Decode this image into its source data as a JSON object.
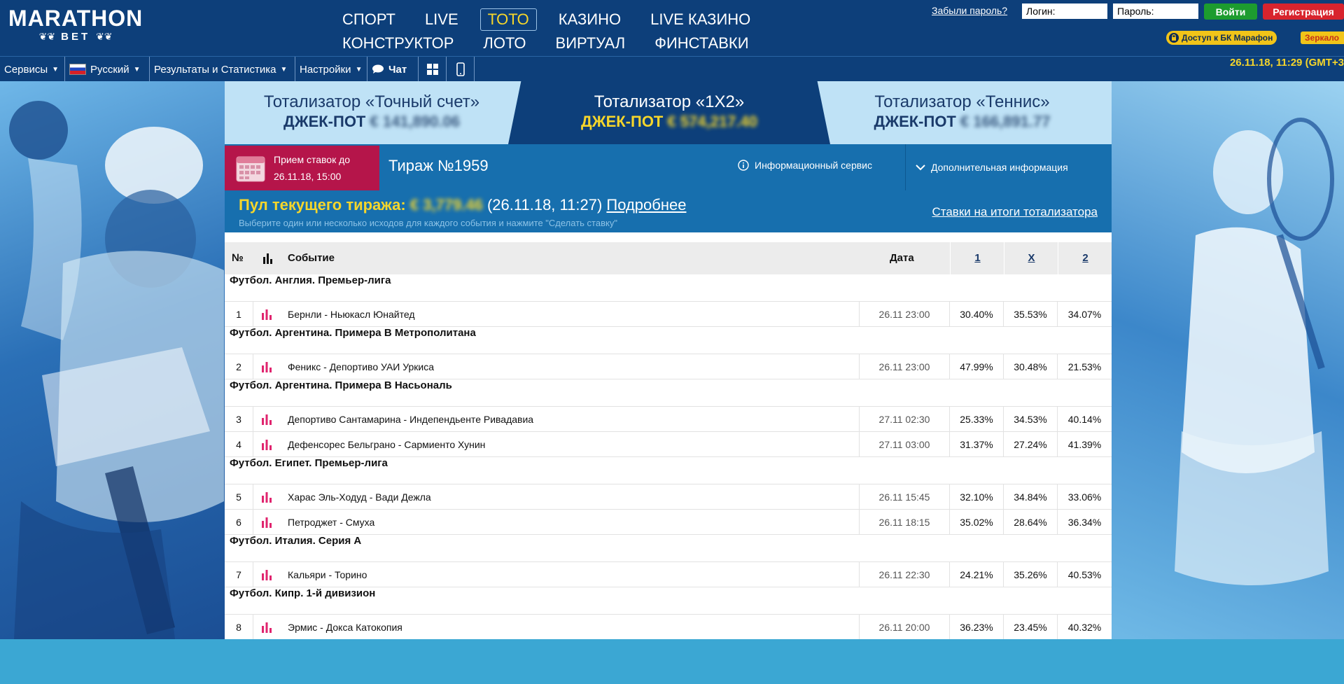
{
  "brand": {
    "name": "MARATHON",
    "sub": "BET",
    "accent": "#0d3f7a",
    "highlight": "#f6d62b"
  },
  "nav": {
    "row1": [
      "СПОРТ",
      "LIVE",
      "ТОТО",
      "КАЗИНО",
      "LIVE КАЗИНО"
    ],
    "row2": [
      "КОНСТРУКТОР",
      "ЛОТО",
      "ВИРТУАЛ",
      "ФИНСТАВКИ"
    ],
    "active": "ТОТО"
  },
  "auth": {
    "forgot": "Забыли пароль?",
    "login_placeholder": "Логин:",
    "password_placeholder": "Пароль:",
    "login_button": "Войти",
    "register_button": "Регистрация",
    "access": "Доступ к БК Марафон",
    "mirror": "Зеркало"
  },
  "toolbar": {
    "services": "Сервисы",
    "language": "Русский",
    "results": "Результаты и Статистика",
    "settings": "Настройки",
    "chat": "Чат",
    "datetime": "26.11.18, 11:29 (GMT+3"
  },
  "jackpots": [
    {
      "title": "Тотализатор «Точный счет»",
      "label": "ДЖЕК-ПОТ",
      "amount": "€ 141,890.06"
    },
    {
      "title": "Тотализатор «1X2»",
      "label": "ДЖЕК-ПОТ",
      "amount": "€ 574,217.40"
    },
    {
      "title": "Тотализатор «Теннис»",
      "label": "ДЖЕК-ПОТ",
      "amount": "€ 166,891.77"
    }
  ],
  "draw": {
    "deadline_label": "Прием ставок до",
    "deadline": "26.11.18, 15:00",
    "title": "Тираж №1959",
    "info_service": "Информационный сервис",
    "more_info": "Дополнительная информация",
    "pool_label": "Пул текущего тиража:",
    "pool_amount": "€ 3,779.46",
    "pool_time": "(26.11.18, 11:27)",
    "pool_more": "Подробнее",
    "hint": "Выберите один или несколько исходов для каждого события и нажмите \"Сделать ставку\"",
    "results_link": "Ставки на итоги тотализатора"
  },
  "table": {
    "headers": {
      "num": "№",
      "event": "Событие",
      "date": "Дата",
      "h1": "1",
      "hx": "X",
      "h2": "2"
    },
    "leagues": [
      {
        "name": "Футбол. Англия. Премьер-лига",
        "rows": [
          {
            "num": "1",
            "event": "Бернли - Ньюкасл Юнайтед",
            "date": "26.11 23:00",
            "p1": "30.40%",
            "px": "35.53%",
            "p2": "34.07%"
          }
        ]
      },
      {
        "name": "Футбол. Аргентина. Примера B Метрополитана",
        "rows": [
          {
            "num": "2",
            "event": "Феникс - Депортиво УАИ Уркиса",
            "date": "26.11 23:00",
            "p1": "47.99%",
            "px": "30.48%",
            "p2": "21.53%"
          }
        ]
      },
      {
        "name": "Футбол. Аргентина. Примера B Насьональ",
        "rows": [
          {
            "num": "3",
            "event": "Депортиво Сантамарина - Индепендьенте Ривадавиа",
            "date": "27.11 02:30",
            "p1": "25.33%",
            "px": "34.53%",
            "p2": "40.14%"
          },
          {
            "num": "4",
            "event": "Дефенсорес Бельграно - Сармиенто Хунин",
            "date": "27.11 03:00",
            "p1": "31.37%",
            "px": "27.24%",
            "p2": "41.39%"
          }
        ]
      },
      {
        "name": "Футбол. Египет. Премьер-лига",
        "rows": [
          {
            "num": "5",
            "event": "Харас Эль-Ходуд - Вади Дежла",
            "date": "26.11 15:45",
            "p1": "32.10%",
            "px": "34.84%",
            "p2": "33.06%"
          },
          {
            "num": "6",
            "event": "Петроджет - Смуха",
            "date": "26.11 18:15",
            "p1": "35.02%",
            "px": "28.64%",
            "p2": "36.34%"
          }
        ]
      },
      {
        "name": "Футбол. Италия. Серия А",
        "rows": [
          {
            "num": "7",
            "event": "Кальяри - Торино",
            "date": "26.11 22:30",
            "p1": "24.21%",
            "px": "35.26%",
            "p2": "40.53%"
          }
        ]
      },
      {
        "name": "Футбол. Кипр. 1-й дивизион",
        "rows": [
          {
            "num": "8",
            "event": "Эрмис - Докса Катокопия",
            "date": "26.11 20:00",
            "p1": "36.23%",
            "px": "23.45%",
            "p2": "40.32%"
          }
        ]
      }
    ]
  }
}
